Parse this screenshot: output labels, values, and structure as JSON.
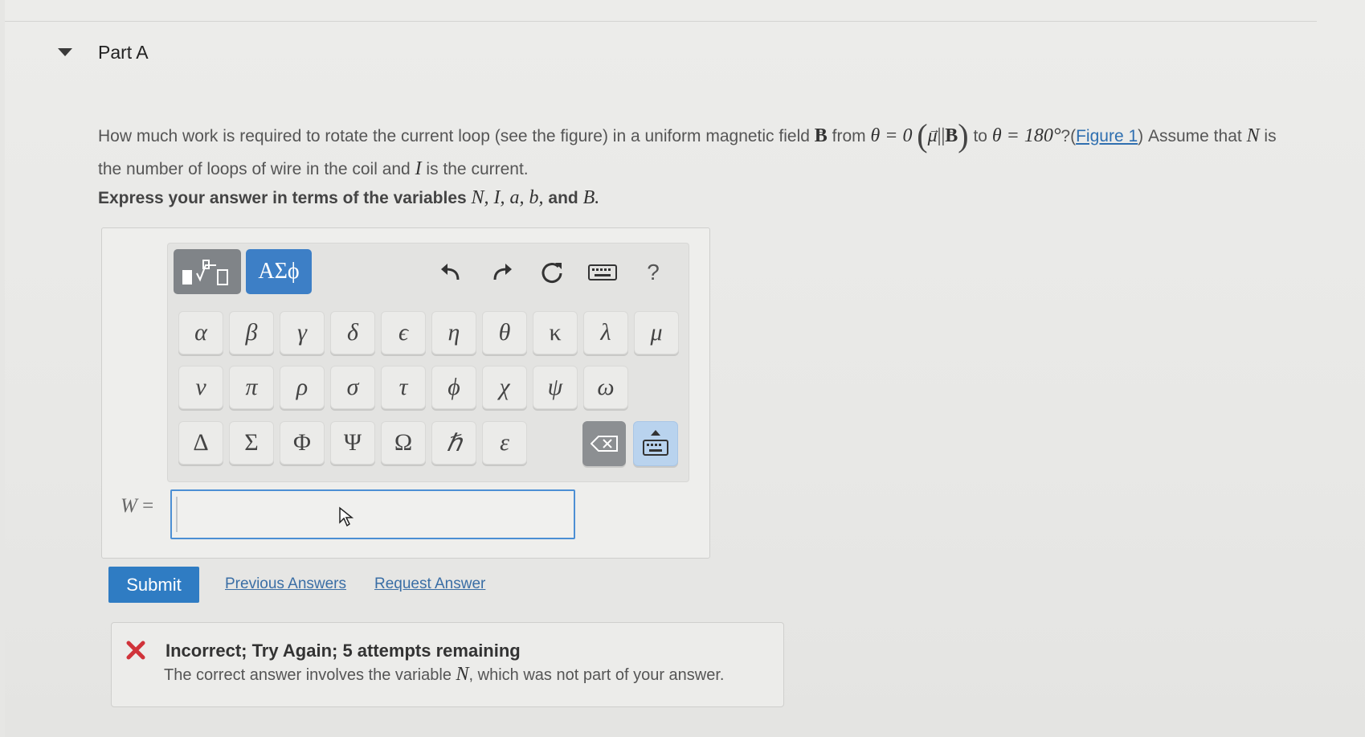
{
  "part": {
    "title": "Part A"
  },
  "question": {
    "t1": "How much work is required to rotate the current loop (see the figure) in a uniform magnetic field",
    "B": "B",
    "t2": "from",
    "theta_eq_0": "θ = 0",
    "mu": "μ",
    "parallel": "||",
    "t3": "to",
    "theta_eq_180": "θ = 180°",
    "q_mark": "?(",
    "figure_link": "Figure 1",
    "t4": ") Assume that",
    "N": "N",
    "t5": "is the number of loops of wire in the coil and",
    "I": "I",
    "t6": "is the current."
  },
  "instruction": {
    "prefix": "Express your answer in terms of the variables",
    "vars": "N, I, a, b,",
    "and": "and",
    "last_var": "B."
  },
  "toolbar": {
    "templates_icon": "templates-icon",
    "symbols_label": "ΑΣϕ",
    "undo_icon": "undo-icon",
    "redo_icon": "redo-icon",
    "reset_icon": "reset-icon",
    "keyboard_icon": "keyboard-icon",
    "help_label": "?"
  },
  "keys": {
    "row1": [
      "α",
      "β",
      "γ",
      "δ",
      "ϵ",
      "η",
      "θ",
      "κ",
      "λ",
      "μ"
    ],
    "row2": [
      "ν",
      "π",
      "ρ",
      "σ",
      "τ",
      "ϕ",
      "χ",
      "ψ",
      "ω"
    ],
    "row3": [
      "Δ",
      "Σ",
      "Φ",
      "Ψ",
      "Ω",
      "ℏ",
      "ε"
    ]
  },
  "answer": {
    "variable": "W",
    "equals": "=",
    "value": ""
  },
  "actions": {
    "submit": "Submit",
    "previous_answers": "Previous Answers",
    "request_answer": "Request Answer"
  },
  "feedback": {
    "title": "Incorrect; Try Again; 5 attempts remaining",
    "t1": "The correct answer involves the variable",
    "var": "N",
    "t2": ", which was not part of your answer."
  },
  "colors": {
    "accent": "#3d7fc6",
    "submit": "#2f7cc3",
    "error": "#d0333a",
    "link": "#3a6ea5"
  }
}
